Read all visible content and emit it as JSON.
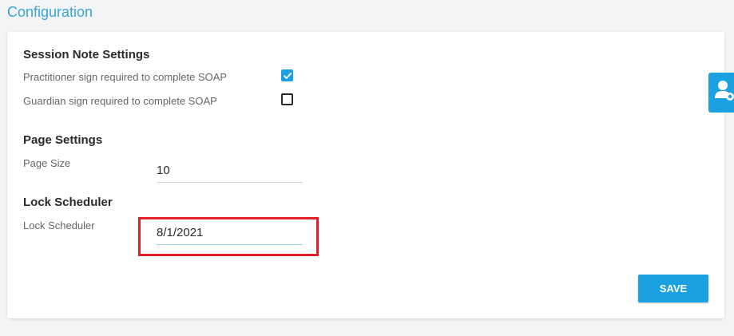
{
  "page": {
    "title": "Configuration"
  },
  "session_note": {
    "title": "Session Note Settings",
    "practitioner_label": "Practitioner sign required to complete SOAP",
    "practitioner_checked": true,
    "guardian_label": "Guardian sign required to complete SOAP",
    "guardian_checked": false
  },
  "page_settings": {
    "title": "Page Settings",
    "page_size_label": "Page Size",
    "page_size_value": "10"
  },
  "lock_scheduler": {
    "title": "Lock Scheduler",
    "field_label": "Lock Scheduler",
    "field_value": "8/1/2021"
  },
  "actions": {
    "save_label": "SAVE"
  },
  "icons": {
    "side_widget": "user-settings-icon",
    "check": "checkmark-icon"
  },
  "colors": {
    "accent": "#1ba1e2",
    "title": "#3aa3d8",
    "highlight": "#e01f2a"
  }
}
